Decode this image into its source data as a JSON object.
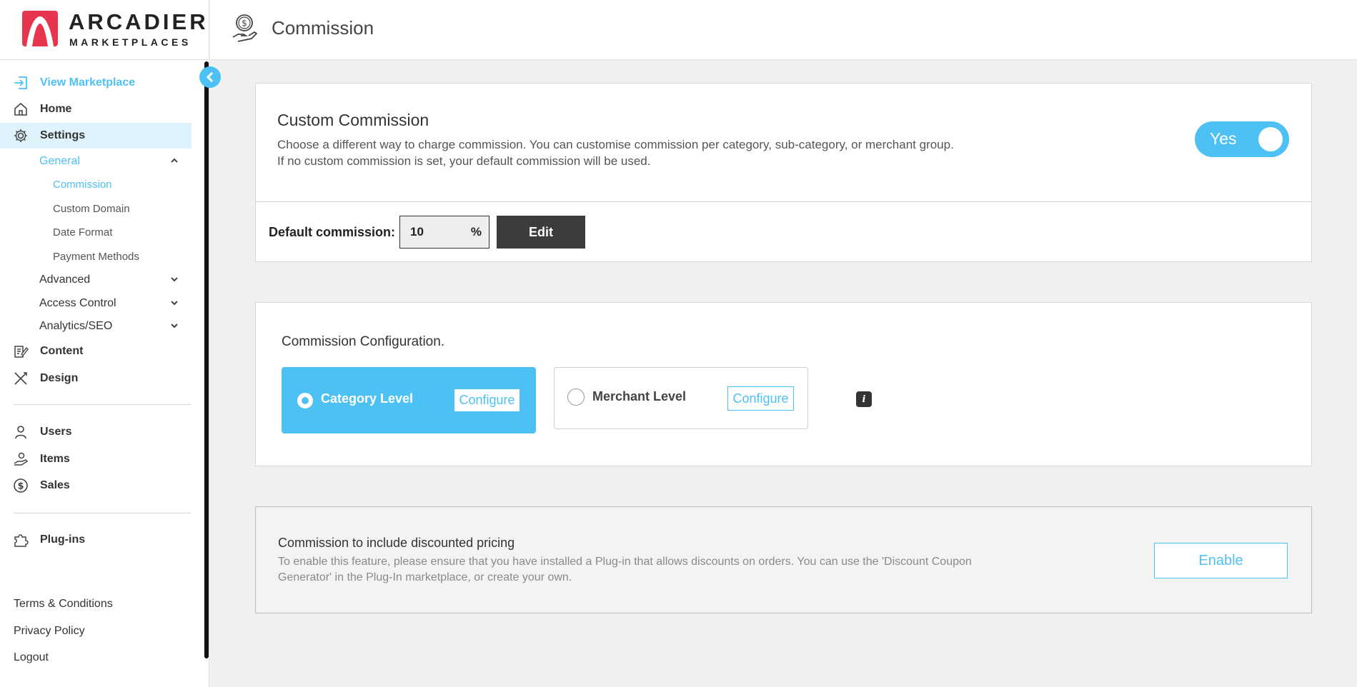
{
  "brand": {
    "name_line1": "ARCADIER",
    "name_line2": "MARKETPLACES",
    "accent_color": "#4dc1f3",
    "logo_color": "#e8344d"
  },
  "sidebar": {
    "collapse_icon": "chevron-left-icon",
    "items": [
      {
        "label": "View Marketplace",
        "icon": "enter-icon"
      },
      {
        "label": "Home",
        "icon": "home-icon"
      },
      {
        "label": "Settings",
        "icon": "gear-icon"
      },
      {
        "label": "Content",
        "icon": "edit-icon"
      },
      {
        "label": "Design",
        "icon": "tools-icon"
      },
      {
        "label": "Users",
        "icon": "user-icon"
      },
      {
        "label": "Items",
        "icon": "hand-icon"
      },
      {
        "label": "Sales",
        "icon": "dollar-icon"
      },
      {
        "label": "Plug-ins",
        "icon": "puzzle-icon"
      }
    ],
    "settings_sub": [
      {
        "label": "General",
        "expanded": true
      },
      {
        "label": "Advanced",
        "expanded": false
      },
      {
        "label": "Access Control",
        "expanded": false
      },
      {
        "label": "Analytics/SEO",
        "expanded": false
      }
    ],
    "general_sub": [
      {
        "label": "Commission",
        "active": true
      },
      {
        "label": "Custom Domain"
      },
      {
        "label": "Date Format"
      },
      {
        "label": "Payment Methods"
      }
    ],
    "footer_links": [
      "Terms & Conditions",
      "Privacy Policy",
      "Logout"
    ]
  },
  "header": {
    "title": "Commission",
    "icon": "commission-icon"
  },
  "custom_commission": {
    "title": "Custom Commission",
    "description_line1": "Choose a different way to charge commission. You can customise commission per category, sub-category, or merchant group.",
    "description_line2": "If no custom commission is set, your default commission will be used.",
    "toggle_label": "Yes",
    "toggle_on": true,
    "default_label": "Default commission:",
    "default_value": "10",
    "default_unit": "%",
    "edit_label": "Edit"
  },
  "configuration": {
    "title": "Commission Configuration.",
    "options": [
      {
        "label": "Category Level",
        "selected": true,
        "configure_label": "Configure"
      },
      {
        "label": "Merchant Level",
        "selected": false,
        "configure_label": "Configure"
      }
    ],
    "info_label": "i"
  },
  "discount": {
    "title": "Commission to include discounted pricing",
    "description_line1": "To enable this feature, please ensure that you have installed a Plug-in that allows discounts on orders. You can use the 'Discount Coupon",
    "description_line2": "Generator' in the Plug-In marketplace, or create your own.",
    "enable_label": "Enable"
  }
}
